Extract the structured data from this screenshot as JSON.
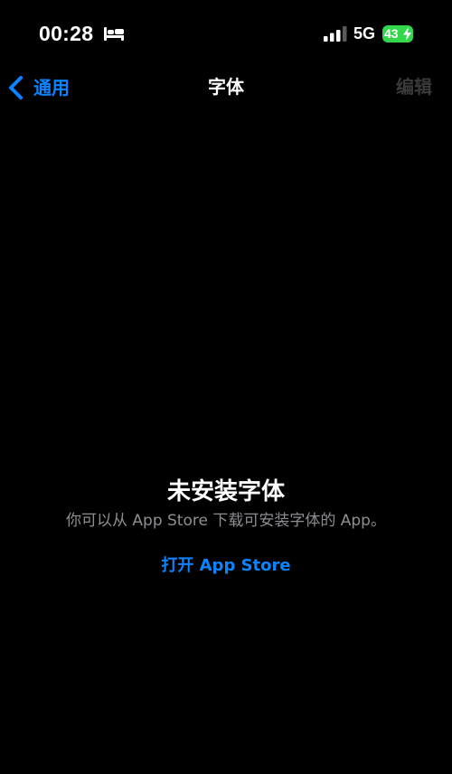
{
  "status_bar": {
    "time": "00:28",
    "network": "5G",
    "battery_level": "43",
    "icons": {
      "sleep": "bed-icon",
      "signal": "cellular-signal-icon",
      "charging": "charging-bolt-icon"
    },
    "colors": {
      "battery": "#32d74b"
    }
  },
  "nav": {
    "back_label": "通用",
    "title": "字体",
    "edit_label": "编辑"
  },
  "empty_state": {
    "title": "未安装字体",
    "subtitle": "你可以从 App Store 下载可安装字体的 App。",
    "action_label": "打开 App Store"
  },
  "colors": {
    "background": "#000000",
    "accent": "#0a84ff",
    "secondary_text": "#8e8e93",
    "disabled_text": "#3a3a3c"
  }
}
